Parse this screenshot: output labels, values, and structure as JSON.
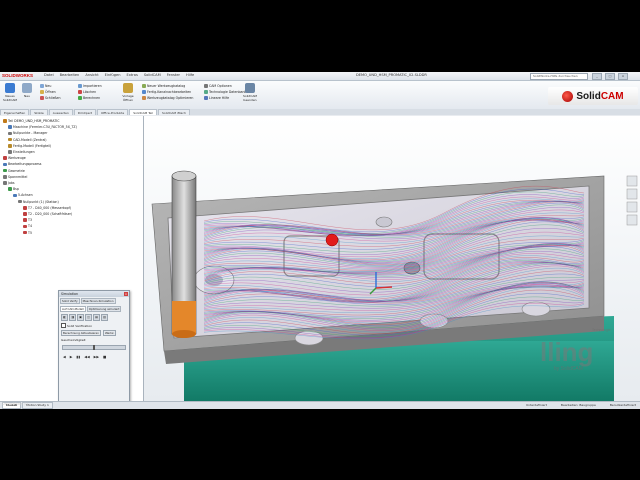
{
  "window": {
    "app_logo": "SOLIDWORKS",
    "menus": [
      "Datei",
      "Bearbeiten",
      "Ansicht",
      "Einfügen",
      "Extras",
      "SolidCAM",
      "Fenster",
      "Hilfe"
    ],
    "document_title": "DEMO_UND_HSM_PROMATIC_02.SLDDR",
    "search_placeholder": "SolidWorks-Hilfe durchsuchen",
    "min": "_",
    "max": "□",
    "close": "×"
  },
  "ribbon": {
    "left_buttons": [
      {
        "label": "Neues SolidCAM",
        "color": "#3b7bd1"
      },
      {
        "label": "Neu",
        "color": "#8fa9c8"
      }
    ],
    "group1": [
      "Neu",
      "Öffnen",
      "Schließen"
    ],
    "group2": [
      "Importieren",
      "Löschen",
      "Berechnen"
    ],
    "mid_button": {
      "label": "Vorlage Öffnen",
      "color": "#c9a23b"
    },
    "group3": [
      "Neuer Werkzeugkatalog",
      "Fertig-Kanalnachbearbeiten",
      "Werkzeugkatalog Optimieren"
    ],
    "group4": [
      "CAM Optionen",
      "Technologie Datenbank",
      "Lineare Hilfe"
    ],
    "right_button": {
      "label": "SolidCAM beenden",
      "color": "#6b86a5"
    }
  },
  "brand": {
    "solid": "Solid",
    "cam": "CAM"
  },
  "tabs": [
    "Eigenschaften",
    "Skizze",
    "Auswerten",
    "DimXpert",
    "Office-Produkte",
    "SolidCAM Teil",
    "SolidCAM iMach"
  ],
  "tabs_active_index": 5,
  "tree": [
    {
      "label": "Teil DEMO_UND_HSM_PROMATIC",
      "indent": 0,
      "color": "#c07a1a"
    },
    {
      "label": "Maschine (Fermler-C3U_FACTOR_5X_TZ)",
      "indent": 1,
      "color": "#4a79b8"
    },
    {
      "label": "Nullpunkte - Manager",
      "indent": 1,
      "color": "#777"
    },
    {
      "label": "CAD-Modell (Zentral)",
      "indent": 1,
      "color": "#b88a2a"
    },
    {
      "label": "Fertig-Modell (Fertigteil)",
      "indent": 1,
      "color": "#b88a2a"
    },
    {
      "label": "Einstellungen",
      "indent": 1,
      "color": "#777"
    },
    {
      "label": "Werkzeuge",
      "indent": 0,
      "color": "#c04040"
    },
    {
      "label": "Bearbeitungsprozess",
      "indent": 0,
      "color": "#4a79b8"
    },
    {
      "label": "Geometrie",
      "indent": 0,
      "color": "#3c9a4a"
    },
    {
      "label": "Spannmittel",
      "indent": 0,
      "color": "#777"
    },
    {
      "label": "Jobs",
      "indent": 0,
      "color": "#777"
    },
    {
      "label": "Bsp",
      "indent": 1,
      "color": "#3c9a4a"
    },
    {
      "label": "5-Achsen",
      "indent": 2,
      "color": "#4a79b8"
    },
    {
      "label": "Nullpunkt (1) (Station)",
      "indent": 3,
      "color": "#777"
    },
    {
      "label": "T7 - D40_000 (Messerkopf)",
      "indent": 4,
      "color": "#c04040"
    },
    {
      "label": "T2 - D20_000 (Schaftfräser)",
      "indent": 4,
      "color": "#c04040"
    },
    {
      "label": "T3",
      "indent": 4,
      "color": "#c04040"
    },
    {
      "label": "T4",
      "indent": 4,
      "color": "#c04040"
    },
    {
      "label": "T5",
      "indent": 4,
      "color": "#c04040"
    }
  ],
  "simulation": {
    "title": "Simulation",
    "tabs": [
      "Solid Verify",
      "Maschinen-Simulation",
      "Auf CAD-Modell",
      "Optimierung simuliert"
    ],
    "tools": [
      "◧",
      "◨",
      "▣",
      "◫",
      "▤",
      "▥"
    ],
    "checkbox_label": "Solid Verification",
    "buttons": [
      "Berechnung Aktualisieren",
      "Werkz."
    ],
    "speed_label": "Geschwindigkeit",
    "speed": 0.5,
    "play_controls": [
      "◀",
      "▶",
      "▮▮",
      "◀◀",
      "▶▶",
      "■"
    ]
  },
  "statusbar": {
    "tabs": [
      "Modell",
      "Motion Study 1"
    ],
    "left_text": "DesignModel (1)",
    "right": [
      "Unterdefiniert",
      "Bearbeiten: Baugruppe",
      "Benutzerdefiniert"
    ]
  },
  "watermark": {
    "text": "lling",
    "by": "by SolidCAM",
    "top": "Technologie"
  }
}
